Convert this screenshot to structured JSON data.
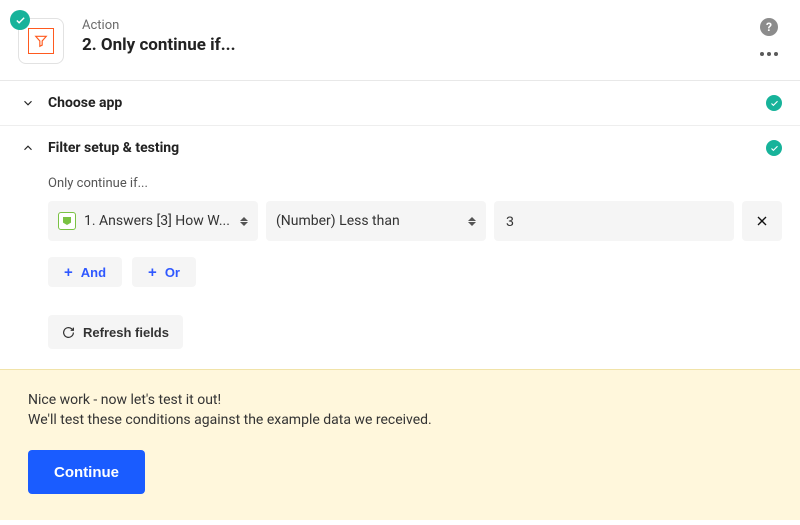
{
  "header": {
    "eyebrow": "Action",
    "title": "2. Only continue if..."
  },
  "sections": {
    "choose_app": "Choose app",
    "filter_setup": "Filter setup & testing"
  },
  "filter": {
    "label": "Only continue if...",
    "field_text": "1. Answers [3] How W...",
    "condition_text": "(Number) Less than",
    "value": "3",
    "and_label": "And",
    "or_label": "Or",
    "refresh_label": "Refresh fields"
  },
  "footer": {
    "line1": "Nice work - now let's test it out!",
    "line2": "We'll test these conditions against the example data we received.",
    "continue_label": "Continue"
  }
}
